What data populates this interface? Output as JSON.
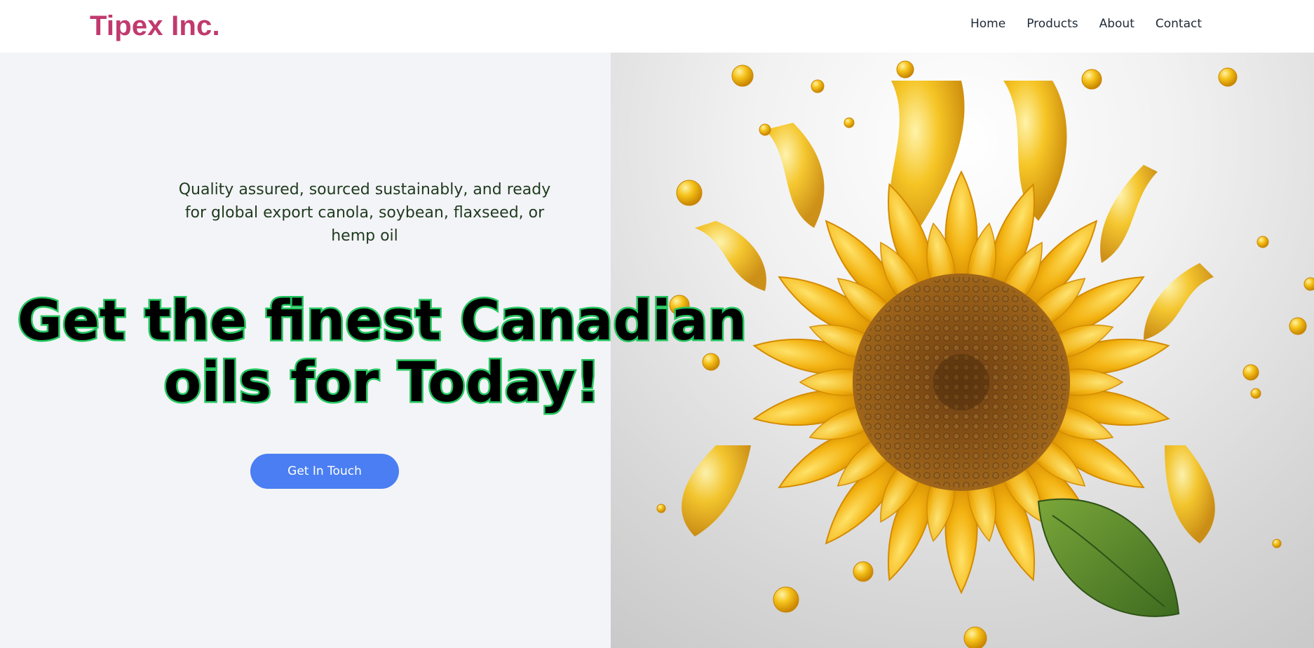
{
  "header": {
    "brand": "Tipex Inc.",
    "nav": [
      "Home",
      "Products",
      "About",
      "Contact"
    ]
  },
  "hero": {
    "subtitle": "Quality assured, sourced sustainably, and ready for global export canola, soybean, flaxseed, or hemp oil",
    "headline_line1": "Get the finest Canadian",
    "headline_line2": "oils for Today!",
    "cta": "Get In Touch"
  },
  "colors": {
    "brand": "#c03a6e",
    "cta": "#4a7ef2",
    "headline_stroke": "#22c55e",
    "hero_bg": "#f3f4f7"
  },
  "image": {
    "subject": "sunflower with oil splash",
    "icon": "sunflower-oil-image"
  }
}
